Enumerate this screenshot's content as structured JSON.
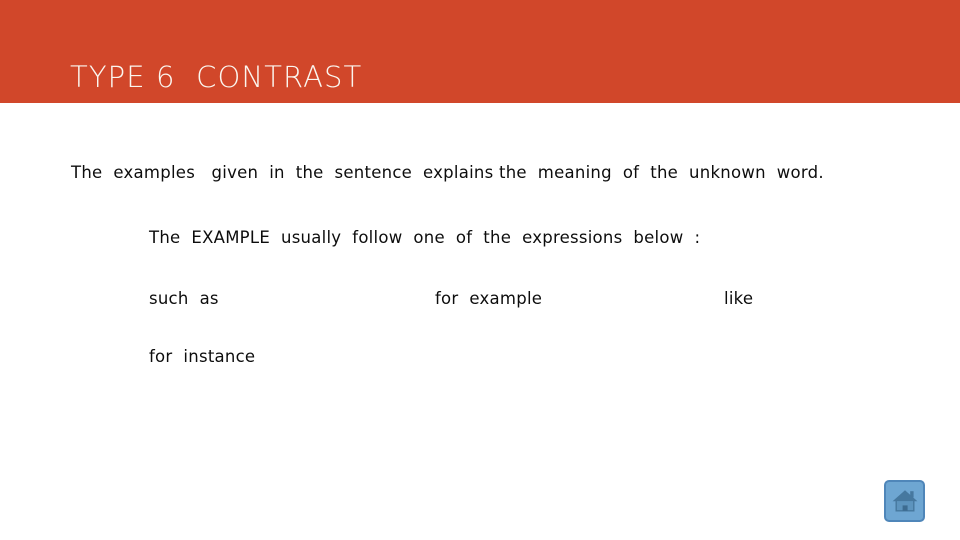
{
  "slide": {
    "title": "TYPE 6  CONTRAST",
    "banner_color": "#d1472a",
    "title_color": "#fbf6ef",
    "background_color": "#ffffff",
    "body_text_color": "#0d0d0d"
  },
  "body": {
    "intro_line": "The  examples   given  in  the  sentence  explains the  meaning  of  the  unknown  word.",
    "lead_line": "The  EXAMPLE  usually  follow  one  of  the  expressions  below  :",
    "expressions": [
      {
        "col1": "such  as",
        "col2": "for  example",
        "col3": "like"
      },
      {
        "col1": "for  instance",
        "col2": "",
        "col3": ""
      }
    ]
  },
  "nav": {
    "home_button": {
      "icon": "home-icon",
      "fill_color": "#6ea6d2",
      "border_color": "#4f86b9",
      "glyph_color": "#46789f"
    }
  }
}
